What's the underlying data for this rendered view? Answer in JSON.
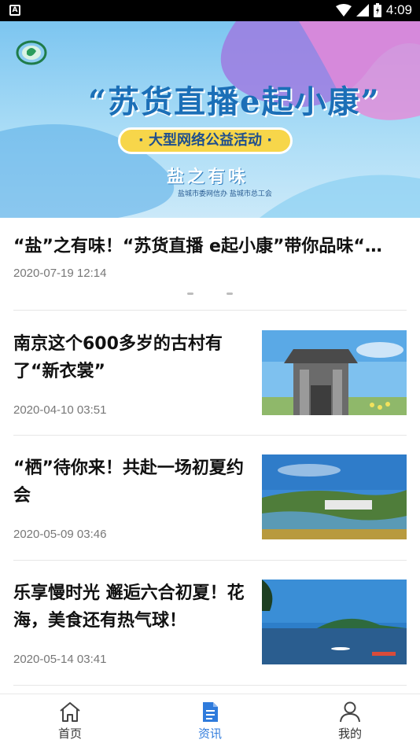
{
  "status_bar": {
    "time": "4:09"
  },
  "banner": {
    "title": "“苏货直播e起小康”",
    "pill": "· 大型网络公益活动 ·",
    "subtitle": "盐之有味",
    "organizers": "盐城市委网信办    盐城市总工会"
  },
  "featured": {
    "title": "“盐”之有味！“苏货直播 e起小康”带你品味“盐城味道”",
    "time": "2020-07-19 12:14"
  },
  "articles": [
    {
      "title": "南京这个600多岁的古村有了“新衣裳”",
      "time": "2020-04-10 03:51"
    },
    {
      "title": "“栖”待你来！共赴一场初夏约会",
      "time": "2020-05-09 03:46"
    },
    {
      "title": "乐享慢时光 邂逅六合初夏！花海，美食还有热气球！",
      "time": "2020-05-14 03:41"
    }
  ],
  "tabs": [
    {
      "label": "首页",
      "icon": "home-icon"
    },
    {
      "label": "资讯",
      "icon": "document-icon"
    },
    {
      "label": "我的",
      "icon": "person-icon"
    }
  ],
  "colors": {
    "accent": "#2f7bdc",
    "text": "#111111",
    "muted": "#777777"
  }
}
